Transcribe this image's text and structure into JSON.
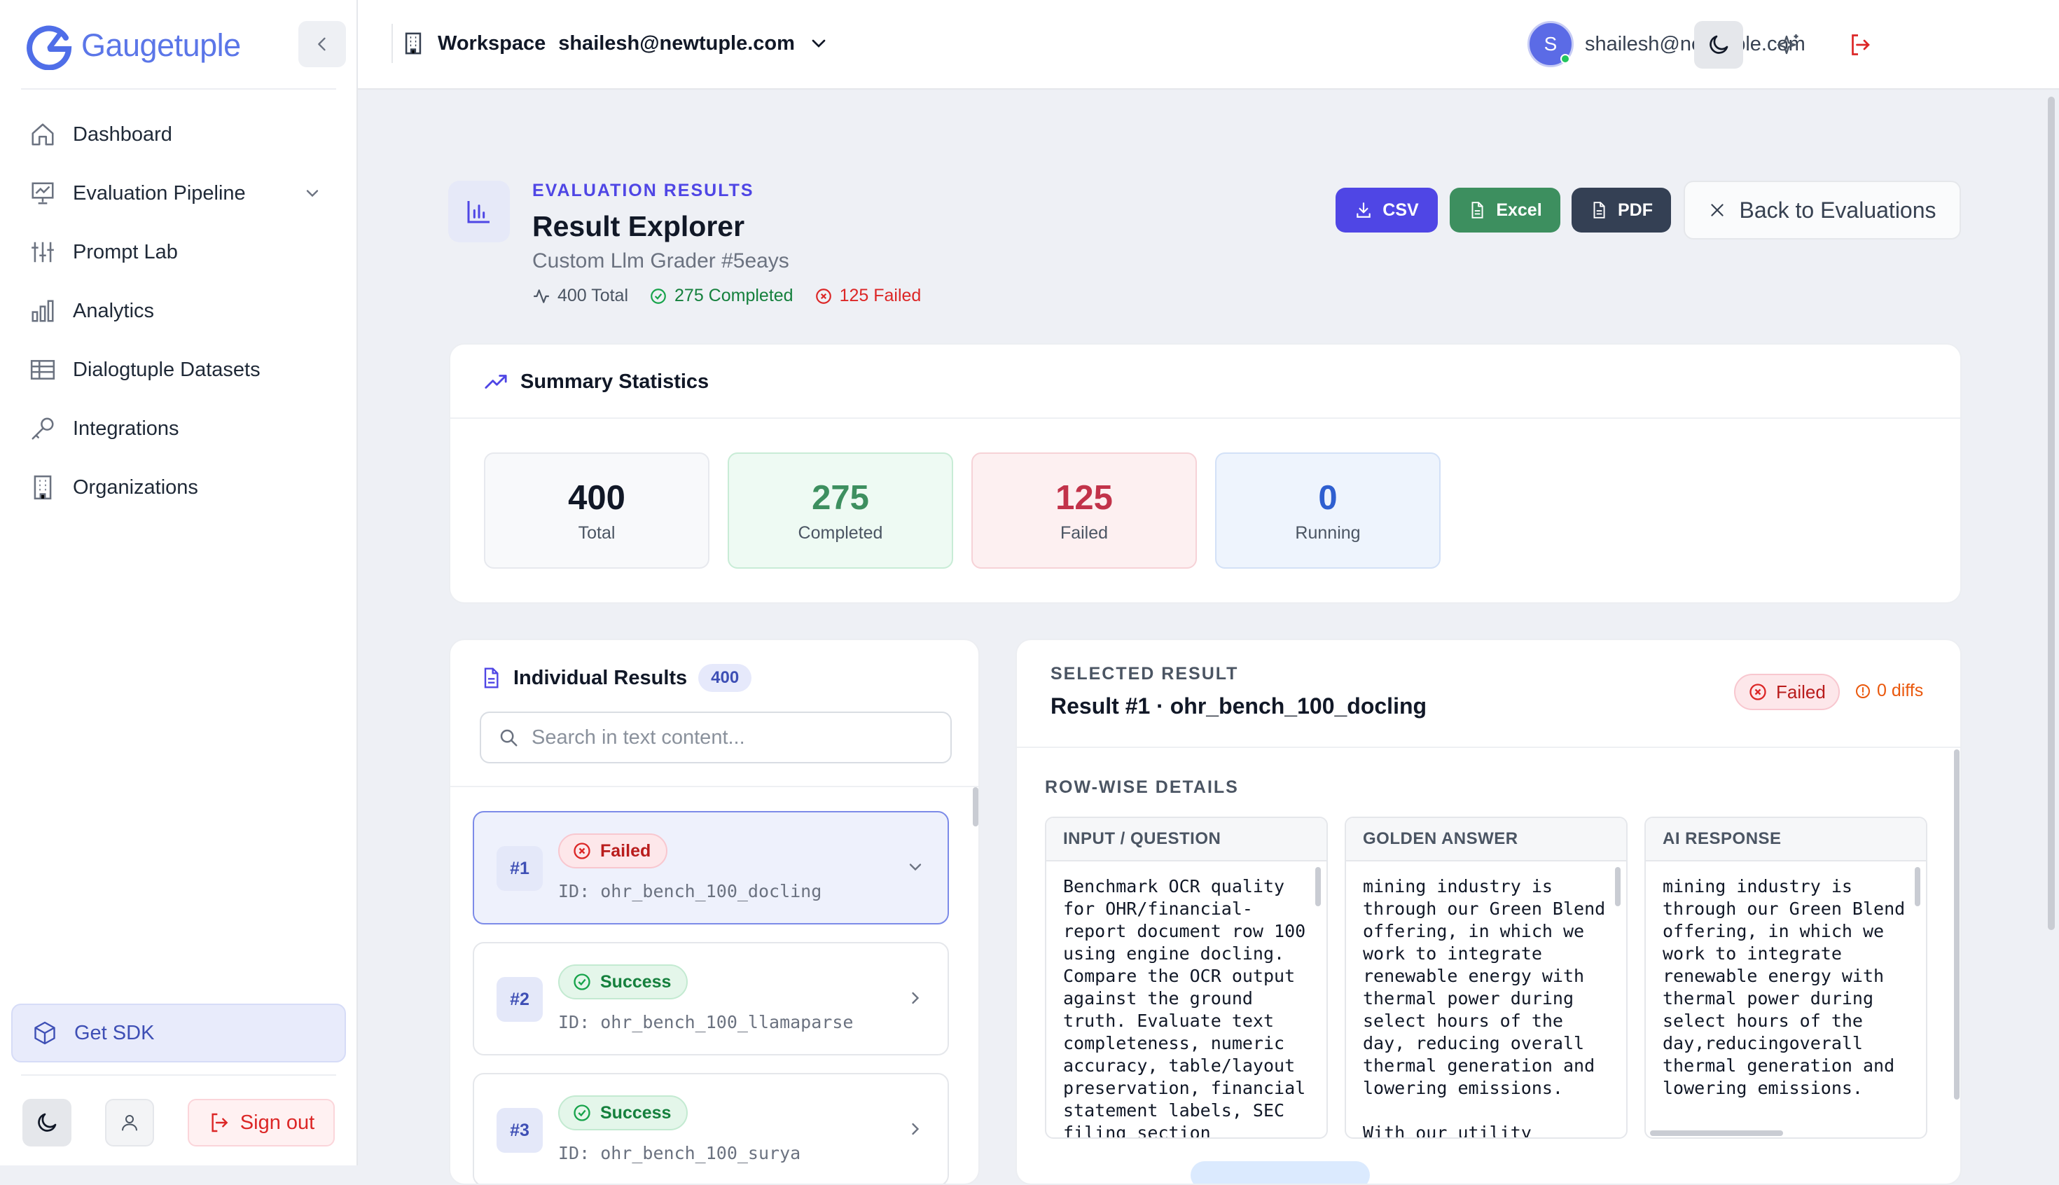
{
  "app": {
    "name": "Gaugetuple"
  },
  "sidebar": {
    "items": [
      {
        "label": "Dashboard",
        "icon": "home-icon"
      },
      {
        "label": "Evaluation Pipeline",
        "icon": "presentation-chart-icon"
      },
      {
        "label": "Prompt Lab",
        "icon": "sliders-icon"
      },
      {
        "label": "Analytics",
        "icon": "bar-chart-icon"
      },
      {
        "label": "Dialogtuple Datasets",
        "icon": "table-icon"
      },
      {
        "label": "Integrations",
        "icon": "key-icon"
      },
      {
        "label": "Organizations",
        "icon": "building-icon"
      }
    ],
    "get_sdk": "Get SDK",
    "sign_out": "Sign out"
  },
  "header": {
    "workspace_label": "Workspace",
    "workspace_email": "shailesh@newtuple.com",
    "avatar_initial": "S",
    "user_email": "shailesh@newtuple.com"
  },
  "page": {
    "eyebrow": "EVALUATION RESULTS",
    "title": "Result Explorer",
    "subtitle": "Custom Llm Grader #5eays",
    "stats": {
      "total": "400 Total",
      "completed": "275 Completed",
      "failed": "125 Failed"
    },
    "actions": {
      "csv": "CSV",
      "excel": "Excel",
      "pdf": "PDF",
      "back": "Back to Evaluations"
    }
  },
  "summary": {
    "title": "Summary Statistics",
    "cards": [
      {
        "value": "400",
        "label": "Total"
      },
      {
        "value": "275",
        "label": "Completed"
      },
      {
        "value": "125",
        "label": "Failed"
      },
      {
        "value": "0",
        "label": "Running"
      }
    ]
  },
  "results": {
    "title": "Individual Results",
    "count": "400",
    "search_placeholder": "Search in text content...",
    "items": [
      {
        "num": "#1",
        "status": "Failed",
        "id": "ID: ohr_bench_100_docling"
      },
      {
        "num": "#2",
        "status": "Success",
        "id": "ID: ohr_bench_100_llamaparse"
      },
      {
        "num": "#3",
        "status": "Success",
        "id": "ID: ohr_bench_100_surya"
      }
    ]
  },
  "detail": {
    "eyebrow": "SELECTED RESULT",
    "title": "Result #1 · ohr_bench_100_docling",
    "status": "Failed",
    "diffs": "0 diffs",
    "section_label": "ROW-WISE DETAILS",
    "columns": [
      {
        "header": "INPUT / QUESTION",
        "text": "Benchmark OCR quality\nfor OHR/financial-\nreport document row 100\nusing engine docling.\nCompare the OCR output\nagainst the ground\ntruth. Evaluate text\ncompleteness, numeric\naccuracy, table/layout\npreservation, financial\nstatement labels, SEC\nfiling section"
      },
      {
        "header": "GOLDEN ANSWER",
        "text": "mining industry is\nthrough our Green Blend\noffering, in which we\nwork to integrate\nrenewable energy with\nthermal power during\nselect hours of the\nday, reducing overall\nthermal generation and\nlowering emissions.\n\nWith our utility"
      },
      {
        "header": "AI RESPONSE",
        "text": "mining industry is\nthrough our Green Blend\noffering, in which we\nwork to integrate\nrenewable energy with\nthermal power during\nselect hours of the\nday,reducingoverall\nthermal generation and\nlowering emissions."
      }
    ]
  }
}
